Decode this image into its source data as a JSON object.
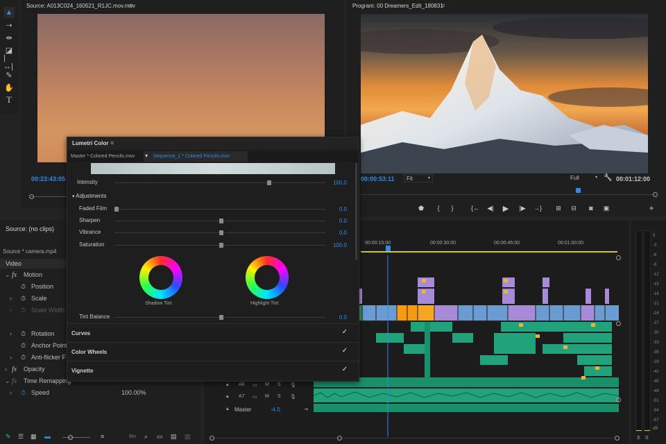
{
  "source_monitor": {
    "title": "Source: A013C024_160521_R1JC.mov.mov",
    "timecode": "00:23:43:05"
  },
  "program_monitor": {
    "title": "Program: 00 Dreamers_Edit_180831",
    "timecode": "00:00:53:11",
    "fit": "Fit",
    "quality": "Full",
    "duration": "00:01:12:00"
  },
  "effect_controls": {
    "title": "Source: (no clips)",
    "clip": "Source * camera.mp4",
    "section_video": "Video",
    "rows": [
      "Motion",
      "Position",
      "Scale",
      "Scale Width",
      "Rotation",
      "Anchor Point",
      "Anti-flicker F",
      "Opacity",
      "Time Remapping",
      "Speed"
    ],
    "speed_value": "100.00%"
  },
  "lumetri": {
    "title": "Lumetri Color",
    "master": "Master * Colored Pencils.mov",
    "sequence": "Sequence_1 * Colored Pencils.mov",
    "intensity_label": "Intensity",
    "intensity_value": "100.0",
    "adjustments": "Adjustments",
    "faded_film": "Faded Film",
    "faded_film_value": "0.0",
    "sharpen": "Sharpen",
    "sharpen_value": "0.0",
    "vibrance": "Vibrance",
    "vibrance_value": "0.0",
    "saturation": "Saturation",
    "saturation_value": "100.0",
    "shadow_tint": "Shadow Tint",
    "highlight_tint": "Highlight Tint",
    "tint_balance": "Tint Balance",
    "tint_balance_value": "0.0",
    "curves": "Curves",
    "color_wheels": "Color Wheels",
    "vignette": "Vignette",
    "check": "✓"
  },
  "timeline": {
    "ruler": [
      "00:00:15:00",
      "00:00:30:00",
      "00:00:45:00",
      "00:01:00:00"
    ],
    "tracks": [
      {
        "name": "A6",
        "m": "M",
        "s": "S"
      },
      {
        "name": "A7",
        "m": "M",
        "s": "S"
      }
    ],
    "master_label": "Master",
    "master_value": "-4.0"
  },
  "vu_meter": {
    "ticks": [
      "0",
      "-3",
      "-6",
      "-9",
      "-12",
      "-15",
      "-18",
      "-21",
      "-24",
      "-27",
      "-30",
      "-33",
      "-36",
      "-39",
      "-42",
      "-45",
      "-48",
      "-51",
      "-54",
      "-57",
      "dB"
    ],
    "solo": [
      "S",
      "S"
    ]
  },
  "bottom_bar": {
    "bin_label": "Bin"
  },
  "colors": {
    "accent": "#2d8ceb",
    "audio_clip": "#21a27a",
    "video_purple": "#a78bd8",
    "video_blue": "#6a9bd1",
    "orange": "#f39c12",
    "playhead": "#2d8ceb"
  }
}
